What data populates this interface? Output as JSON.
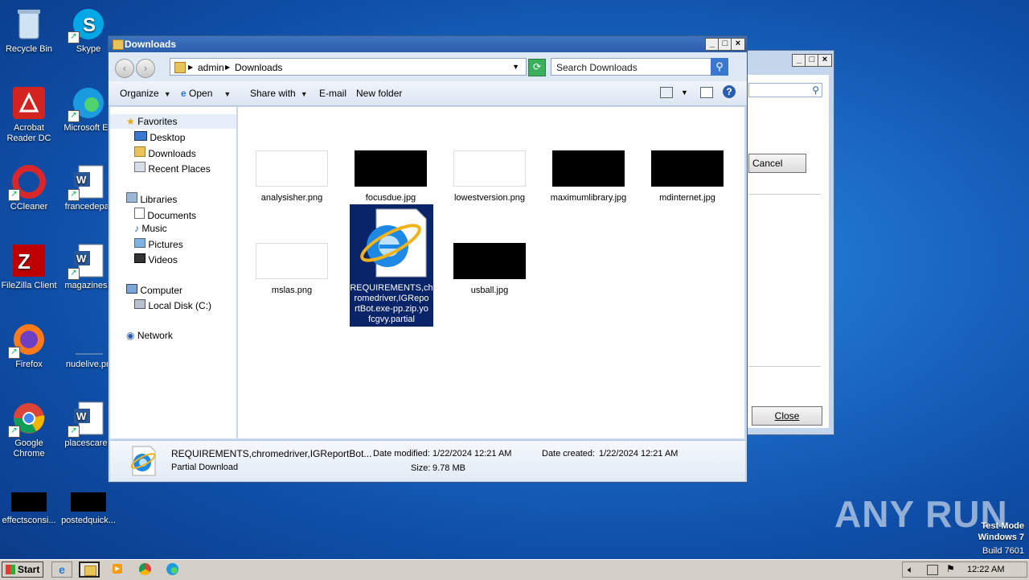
{
  "desktop": {
    "icons": [
      {
        "label": "Recycle Bin",
        "icon": "recycle-bin-icon"
      },
      {
        "label": "Skype",
        "icon": "skype-icon"
      },
      {
        "label": "Acrobat Reader DC",
        "icon": "acrobat-icon"
      },
      {
        "label": "Microsoft Ed",
        "icon": "edge-icon"
      },
      {
        "label": "CCleaner",
        "icon": "ccleaner-icon"
      },
      {
        "label": "francedepar",
        "icon": "word-doc-icon"
      },
      {
        "label": "FileZilla Client",
        "icon": "filezilla-icon"
      },
      {
        "label": "magazinesp",
        "icon": "word-doc-icon"
      },
      {
        "label": "Firefox",
        "icon": "firefox-icon"
      },
      {
        "label": "nudelive.pn",
        "icon": "image-file-icon"
      },
      {
        "label": "Google Chrome",
        "icon": "chrome-icon"
      },
      {
        "label": "placescaree",
        "icon": "word-doc-icon"
      },
      {
        "label": "effectsconsi...",
        "icon": "black-image-icon"
      },
      {
        "label": "postedquick...",
        "icon": "black-image-icon"
      }
    ]
  },
  "background_dialog": {
    "cancel_label": "Cancel",
    "close_label": "Close"
  },
  "window": {
    "title": "Downloads",
    "breadcrumb": [
      "admin",
      "Downloads"
    ],
    "search_placeholder": "Search Downloads",
    "toolbar": {
      "organize": "Organize",
      "open": "Open",
      "share_with": "Share with",
      "email": "E-mail",
      "new_folder": "New folder"
    },
    "nav": {
      "favorites": "Favorites",
      "desktop": "Desktop",
      "downloads": "Downloads",
      "recent_places": "Recent Places",
      "libraries": "Libraries",
      "documents": "Documents",
      "music": "Music",
      "pictures": "Pictures",
      "videos": "Videos",
      "computer": "Computer",
      "local_disk": "Local Disk (C:)",
      "network": "Network"
    },
    "files": [
      {
        "name": "analysisher.png",
        "thumb": "white"
      },
      {
        "name": "focusdue.jpg",
        "thumb": "black"
      },
      {
        "name": "lowestversion.png",
        "thumb": "white"
      },
      {
        "name": "maximumlibrary.jpg",
        "thumb": "black"
      },
      {
        "name": "mdinternet.jpg",
        "thumb": "black"
      },
      {
        "name": "mslas.png",
        "thumb": "white"
      },
      {
        "name": "REQUIREMENTS,chromedriver,IGReportBot.exe-pp.zip.yofcgvy.partial",
        "thumb": "ie"
      },
      {
        "name": "usball.jpg",
        "thumb": "black"
      }
    ],
    "selected_file_lines": [
      "REQUIREMENTS,ch",
      "romedriver,IGRepo",
      "rtBot.exe-pp.zip.yo",
      "fcgvy.partial"
    ],
    "details": {
      "name": "REQUIREMENTS,chromedriver,IGReportBot...",
      "type": "Partial Download",
      "date_modified_label": "Date modified:",
      "date_modified": "1/22/2024 12:21 AM",
      "size_label": "Size:",
      "size": "9.78 MB",
      "date_created_label": "Date created:",
      "date_created": "1/22/2024 12:21 AM"
    }
  },
  "taskbar": {
    "start_label": "Start",
    "clock": "12:22 AM"
  },
  "watermark": {
    "text": "ANY RUN",
    "test_mode": "Test Mode",
    "os": "Windows 7",
    "build": "Build 7601"
  }
}
